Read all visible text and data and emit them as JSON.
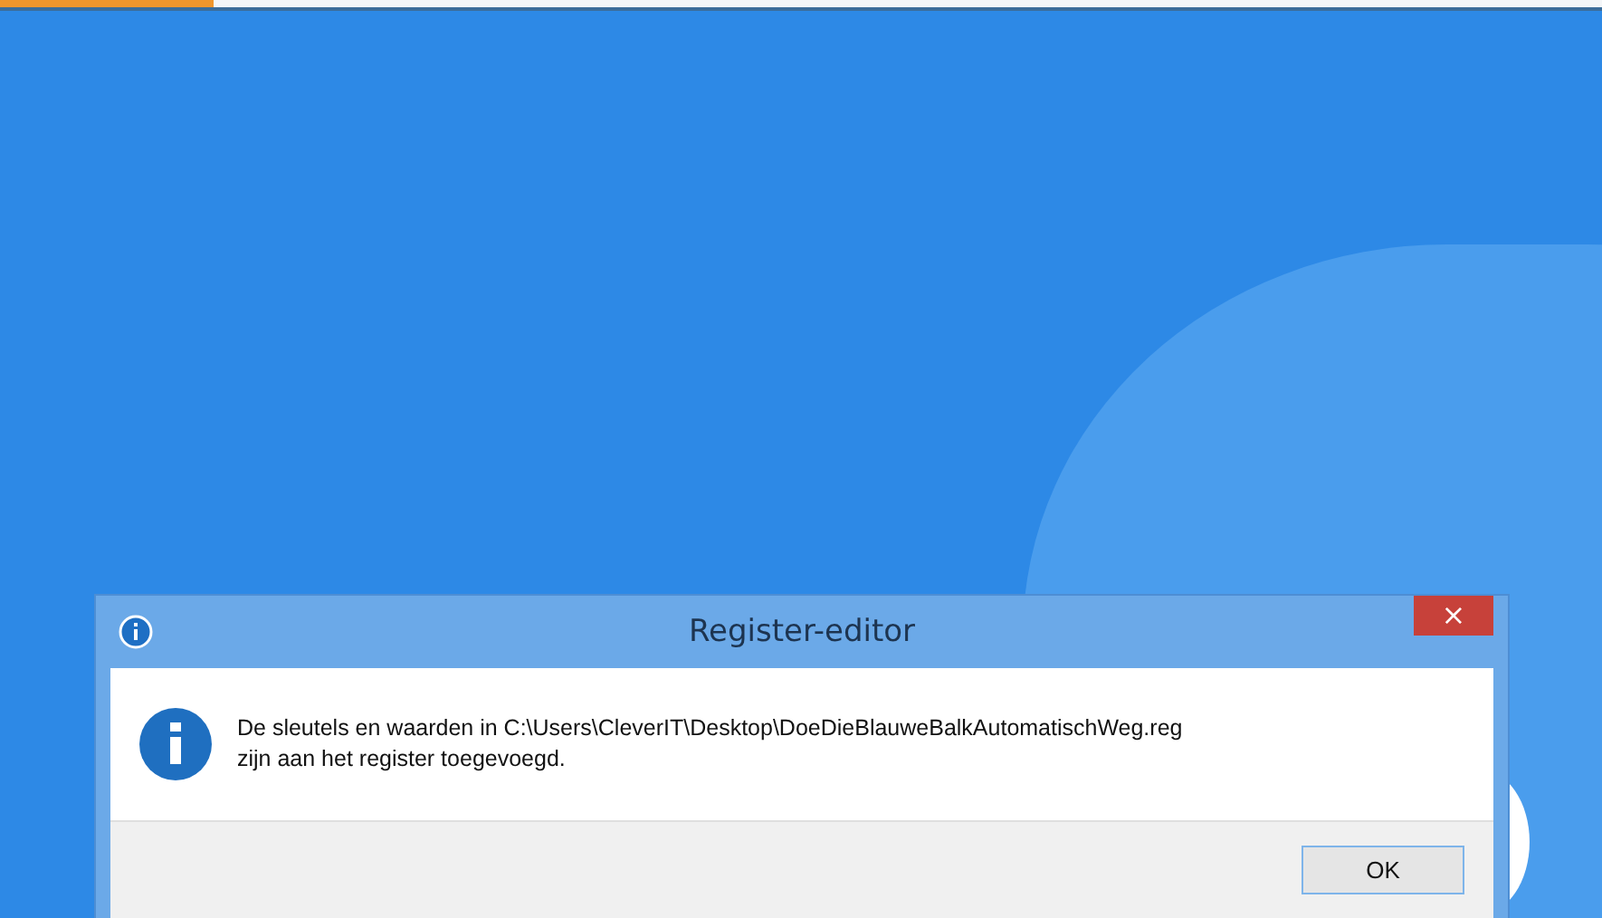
{
  "dialog": {
    "title": "Register-editor",
    "message_lines": [
      "De sleutels en waarden in C:\\Users\\CleverIT\\Desktop\\DoeDieBlauweBalkAutomatischWeg.reg",
      "zijn aan het register toegevoegd."
    ],
    "close_button": "×",
    "buttons": [
      "OK"
    ]
  }
}
